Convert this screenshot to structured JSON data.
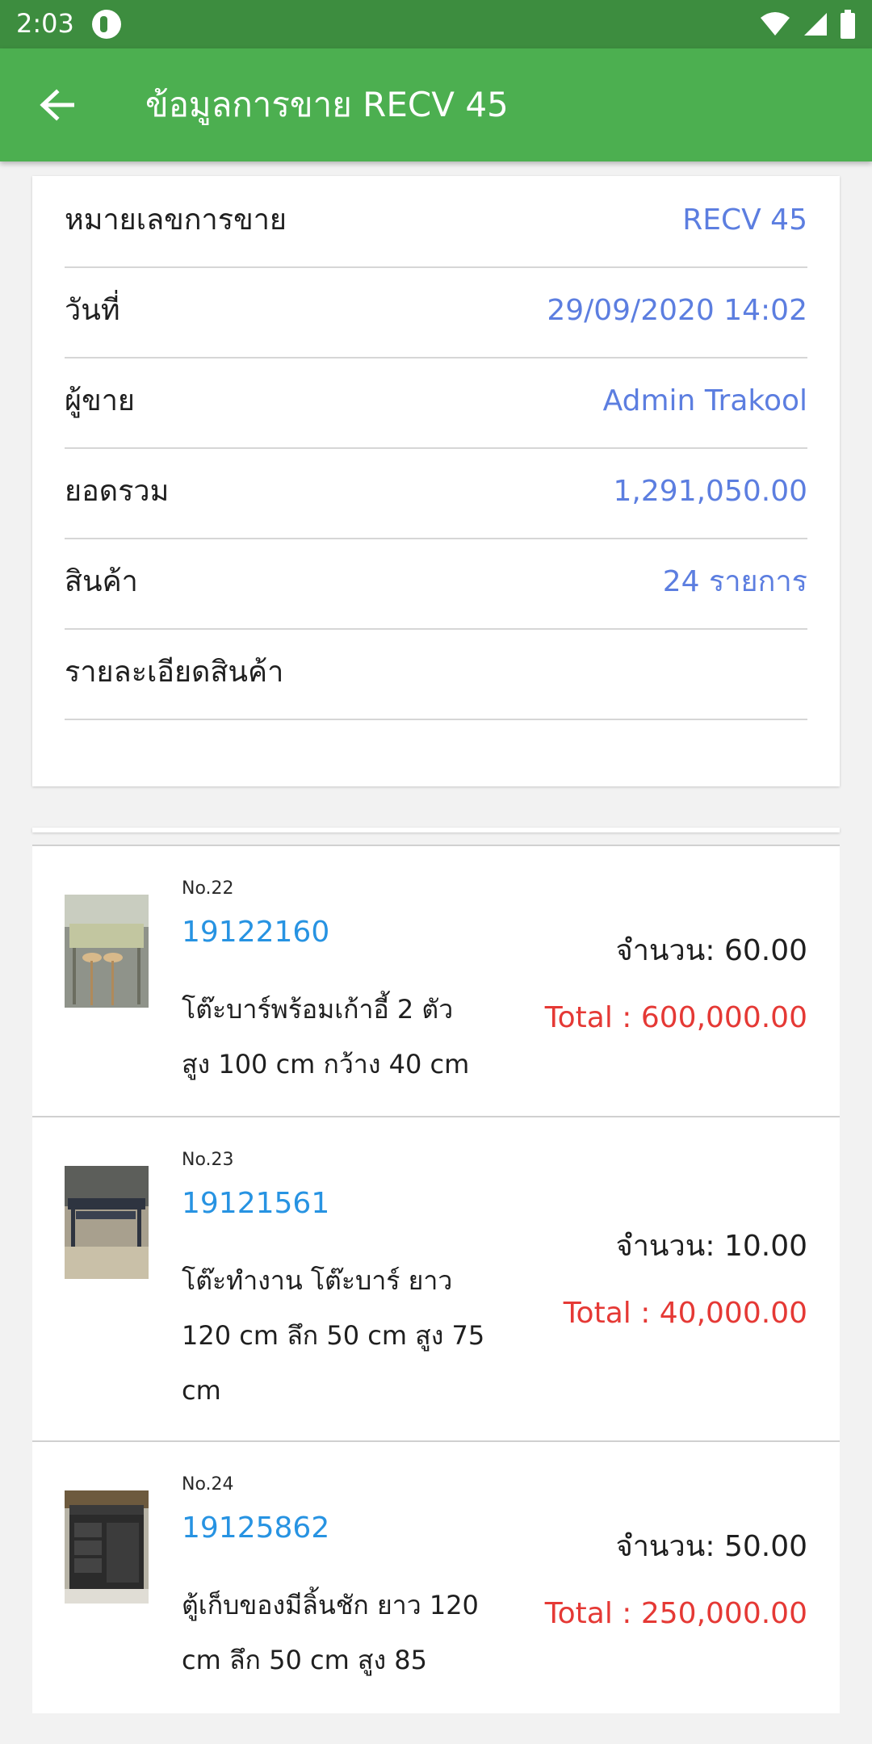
{
  "status_bar": {
    "time": "2:03",
    "icons": [
      "app-notification-icon",
      "wifi-icon",
      "signal-icon",
      "battery-icon"
    ]
  },
  "app_bar": {
    "back_icon": "arrow-left-icon",
    "title": "ข้อมูลการขาย RECV 45"
  },
  "sale_info": {
    "rows": [
      {
        "label": "หมายเลขการขาย",
        "value": "RECV 45"
      },
      {
        "label": "วันที่",
        "value": "29/09/2020 14:02"
      },
      {
        "label": "ผู้ขาย",
        "value": "Admin Trakool"
      },
      {
        "label": "ยอดรวม",
        "value": "1,291,050.00"
      },
      {
        "label": "สินค้า",
        "value": "24 รายการ"
      },
      {
        "label": "รายละเอียดสินค้า",
        "value": ""
      }
    ]
  },
  "items": [
    {
      "no": "No.22",
      "code": "19122160",
      "desc_line1": "โต๊ะบาร์พร้อมเก้าอี้ 2 ตัว",
      "desc_line2": "สูง 100 cm กว้าง 40 cm",
      "desc_line3": "",
      "qty": "จำนวน: 60.00",
      "total": "Total : 600,000.00"
    },
    {
      "no": "No.23",
      "code": "19121561",
      "desc_line1": "โต๊ะทำงาน โต๊ะบาร์  ยาว",
      "desc_line2": "120 cm ลึก 50 cm สูง 75",
      "desc_line3": "cm",
      "qty": "จำนวน: 10.00",
      "total": "Total : 40,000.00"
    },
    {
      "no": "No.24",
      "code": "19125862",
      "desc_line1": "ตู้เก็บของมีลิ้นชัก ยาว 120",
      "desc_line2": "cm ลึก 50 cm สูง 85",
      "desc_line3": "",
      "qty": "จำนวน: 50.00",
      "total": "Total : 250,000.00"
    }
  ],
  "colors": {
    "app_bar": "#4caf50",
    "status_bar": "#3d8d3f",
    "value_blue": "#5c7ee0",
    "code_blue": "#2793e2",
    "total_red": "#e53935"
  }
}
